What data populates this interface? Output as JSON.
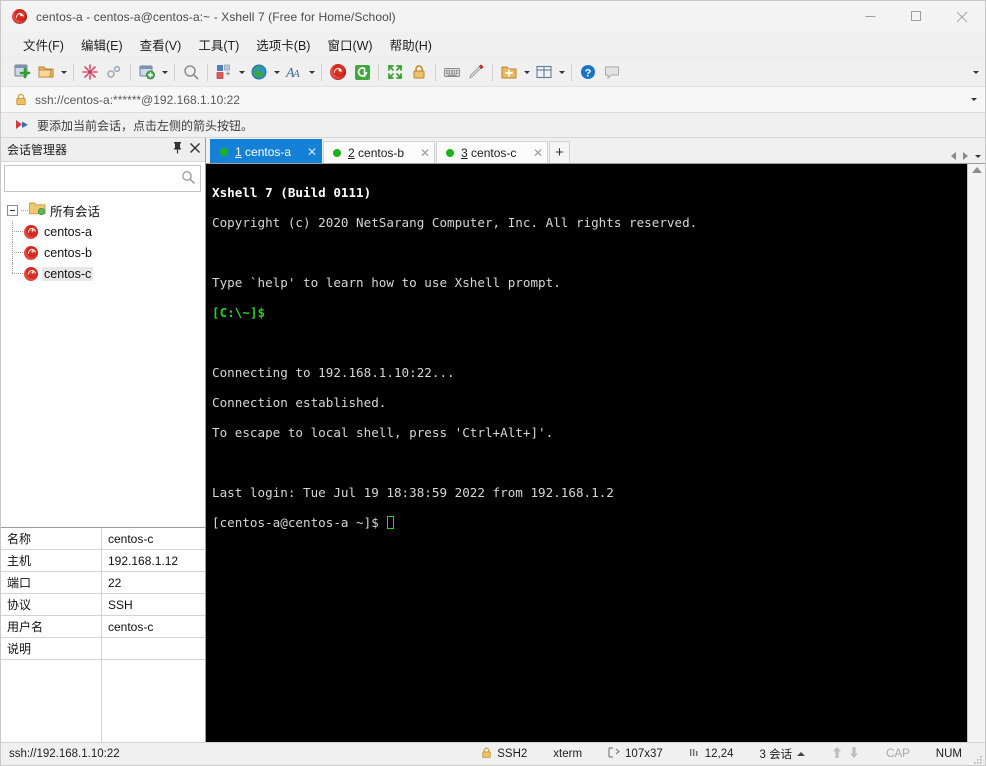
{
  "window": {
    "title": "centos-a - centos-a@centos-a:~ - Xshell 7 (Free for Home/School)",
    "app_icon": "xshell-spiral-icon",
    "minimize_label": "—",
    "maximize_label": "□",
    "close_label": "✕"
  },
  "menu": {
    "items": [
      {
        "label": "文件(F)",
        "name": "menu-file"
      },
      {
        "label": "编辑(E)",
        "name": "menu-edit"
      },
      {
        "label": "查看(V)",
        "name": "menu-view"
      },
      {
        "label": "工具(T)",
        "name": "menu-tools"
      },
      {
        "label": "选项卡(B)",
        "name": "menu-tabs"
      },
      {
        "label": "窗口(W)",
        "name": "menu-window"
      },
      {
        "label": "帮助(H)",
        "name": "menu-help"
      }
    ]
  },
  "toolbar": {
    "icons": [
      "new-session-icon",
      "open-session-icon",
      "disconnect-icon",
      "link-icon",
      "session-manager-icon",
      "find-icon",
      "layout-icon",
      "globe-icon",
      "font-icon",
      "xshell-icon",
      "xftp-icon",
      "fullscreen-icon",
      "lock-icon",
      "keyboard-icon",
      "highlight-pen-icon",
      "new-folder-icon",
      "split-view-icon",
      "help-icon",
      "feedback-icon"
    ],
    "overflow_label": "▼"
  },
  "address": {
    "value": "ssh://centos-a:******@192.168.1.10:22",
    "lock_icon": "lock-icon",
    "dropdown_label": "▼"
  },
  "hint": {
    "icon": "arrow-pointer-icon",
    "text": "要添加当前会话，点击左侧的箭头按钮。"
  },
  "session_manager": {
    "title": "会话管理器",
    "pin_label": "固定",
    "close_label": "✕",
    "search": {
      "value": "",
      "placeholder": ""
    },
    "tree": {
      "root_label": "所有会话",
      "sessions": [
        {
          "label": "centos-a",
          "selected": false
        },
        {
          "label": "centos-b",
          "selected": false
        },
        {
          "label": "centos-c",
          "selected": true
        }
      ]
    },
    "properties": [
      {
        "key": "名称",
        "value": "centos-c"
      },
      {
        "key": "主机",
        "value": "192.168.1.12"
      },
      {
        "key": "端口",
        "value": "22"
      },
      {
        "key": "协议",
        "value": "SSH"
      },
      {
        "key": "用户名",
        "value": "centos-c"
      },
      {
        "key": "说明",
        "value": ""
      }
    ]
  },
  "tabs": {
    "items": [
      {
        "num": "1",
        "label": "centos-a",
        "active": true
      },
      {
        "num": "2",
        "label": "centos-b",
        "active": false
      },
      {
        "num": "3",
        "label": "centos-c",
        "active": false
      }
    ],
    "add_label": "+",
    "overflow_label": "▼"
  },
  "terminal": {
    "lines": [
      {
        "text": "Xshell 7 (Build 0111)",
        "style": "bold"
      },
      {
        "text": "Copyright (c) 2020 NetSarang Computer, Inc. All rights reserved.",
        "style": "norm"
      },
      {
        "text": "",
        "style": "norm"
      },
      {
        "text": "Type `help' to learn how to use Xshell prompt.",
        "style": "norm"
      },
      {
        "text": "[C:\\~]$",
        "style": "green"
      },
      {
        "text": "",
        "style": "norm"
      },
      {
        "text": "Connecting to 192.168.1.10:22...",
        "style": "norm"
      },
      {
        "text": "Connection established.",
        "style": "norm"
      },
      {
        "text": "To escape to local shell, press 'Ctrl+Alt+]'.",
        "style": "norm"
      },
      {
        "text": "",
        "style": "norm"
      },
      {
        "text": "Last login: Tue Jul 19 18:38:59 2022 from 192.168.1.2",
        "style": "norm"
      },
      {
        "text": "[centos-a@centos-a ~]$ ",
        "style": "norm",
        "cursor": true
      }
    ]
  },
  "statusbar": {
    "left": "ssh://192.168.1.10:22",
    "protocol": "SSH2",
    "terminal_type": "xterm",
    "size": "107x37",
    "position": "12,24",
    "sessions": "3 会话",
    "cap": "CAP",
    "num": "NUM"
  },
  "colors": {
    "accent": "#1581d6",
    "terminal_bg": "#000000",
    "terminal_fg": "#d6d6d6",
    "prompt_green": "#23d123",
    "tab_dot": "#19b319",
    "chrome_bg": "#f0f0f0"
  }
}
